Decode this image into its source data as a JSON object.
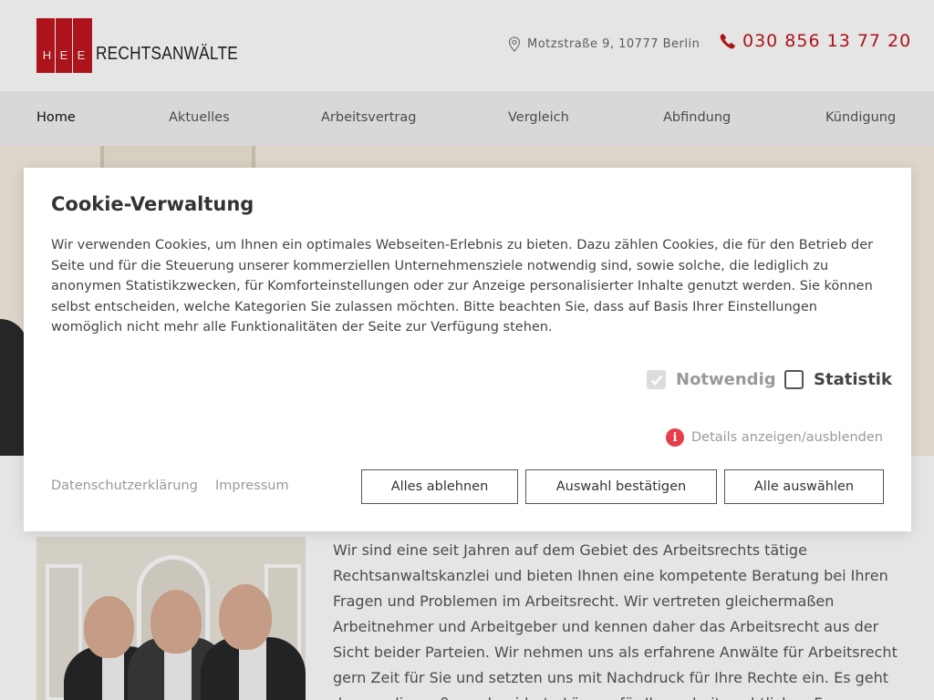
{
  "header": {
    "logo_letters": [
      "H",
      "E",
      "E"
    ],
    "logo_text": "RECHTSANWÄLTE",
    "address": "Motzstraße 9, 10777 Berlin",
    "phone": "030 856 13 77 20"
  },
  "nav": {
    "items": [
      {
        "label": "Home"
      },
      {
        "label": "Aktuelles"
      },
      {
        "label": "Arbeitsvertrag"
      },
      {
        "label": "Vergleich"
      },
      {
        "label": "Abfindung"
      },
      {
        "label": "Kündigung"
      }
    ]
  },
  "content": {
    "intro": "Wir sind eine seit Jahren auf dem Gebiet des Arbeitsrechts tätige Rechtsanwaltskanzlei und bieten Ihnen eine kompetente Beratung bei Ihren Fragen und Problemen im Arbeitsrecht. Wir vertreten gleichermaßen Arbeitnehmer und Arbeitgeber und kennen daher das Arbeitsrecht aus der Sicht beider Parteien. Wir nehmen uns als erfahrene Anwälte für Arbeitsrecht gern Zeit für Sie und setzten uns mit Nachdruck für Ihre Rechte ein. Es geht darum, die maß geschneiderte Lösung für Ihre arbeitsrechtlichen Fragen zu"
  },
  "cookie": {
    "title": "Cookie-Verwaltung",
    "description": "Wir verwenden Cookies, um Ihnen ein optimales Webseiten-Erlebnis zu bieten. Dazu zählen Cookies, die für den Betrieb der Seite und für die Steuerung unserer kommerziellen Unternehmensziele notwendig sind, sowie solche, die lediglich zu anonymen Statistikzwecken, für Komforteinstellungen oder zur Anzeige personalisierter Inhalte genutzt werden. Sie können selbst entscheiden, welche Kategorien Sie zulassen möchten. Bitte beachten Sie, dass auf Basis Ihrer Einstellungen womöglich nicht mehr alle Funktionalitäten der Seite zur Verfügung stehen.",
    "options": [
      {
        "label": "Notwendig",
        "checked": true,
        "disabled": true
      },
      {
        "label": "Statistik",
        "checked": false,
        "disabled": false
      }
    ],
    "details_link": "Details anzeigen/ausblenden",
    "privacy_link": "Datenschutzerklärung",
    "imprint_link": "Impressum",
    "buttons": {
      "reject_all": "Alles ablehnen",
      "confirm_selection": "Auswahl bestätigen",
      "accept_all": "Alle auswählen"
    },
    "colors": {
      "accent": "#c0161d",
      "info": "#e53e4b"
    }
  }
}
